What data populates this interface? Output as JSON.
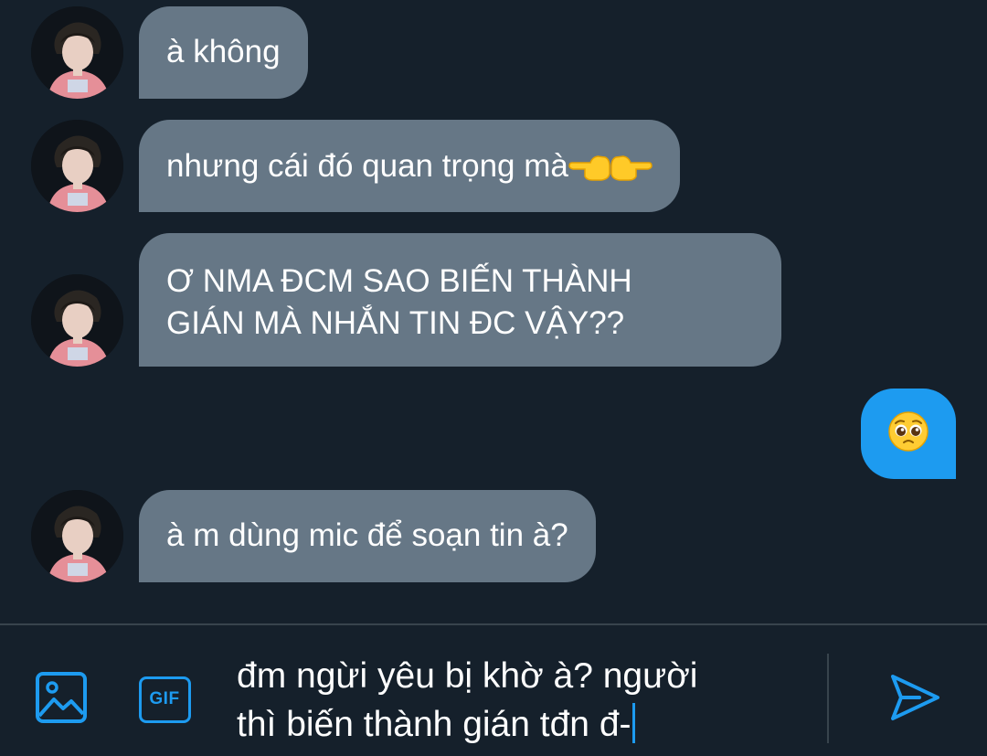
{
  "conversation": {
    "messages": [
      {
        "sender": "other",
        "lines": [
          "à không"
        ]
      },
      {
        "sender": "other",
        "lines": [
          "nhưng cái đó quan trọng mà"
        ],
        "emoji": [
          "point-left-hand",
          "point-right-hand"
        ]
      },
      {
        "sender": "other",
        "lines": [
          "Ơ NMA ĐCM SAO BIẾN THÀNH",
          "GIÁN MÀ NHẮN TIN ĐC VẬY??"
        ]
      },
      {
        "sender": "me",
        "emoji": "pleading-face"
      },
      {
        "sender": "other",
        "lines": [
          "à m dùng mic để soạn tin à?"
        ]
      }
    ]
  },
  "composer": {
    "text_lines": [
      "đm ngừi yêu bị khờ à? người",
      "thì biến thành gián tđn đ-"
    ],
    "gif_label": "GIF",
    "icons": [
      "image-icon",
      "gif-icon",
      "send-icon"
    ]
  },
  "colors": {
    "background": "#15202b",
    "incoming_bubble": "#667786",
    "outgoing_bubble": "#1d9bf0",
    "accent": "#1d9bf0"
  }
}
